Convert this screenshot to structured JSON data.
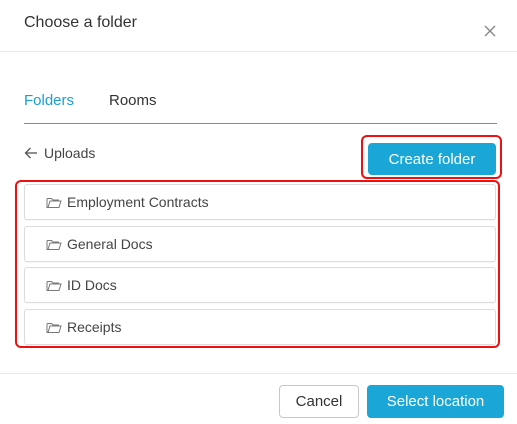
{
  "dialog": {
    "title": "Choose a folder",
    "close_icon": "close-icon"
  },
  "tabs": [
    {
      "label": "Folders",
      "active": true
    },
    {
      "label": "Rooms",
      "active": false
    }
  ],
  "navigation": {
    "back_icon": "arrow-left-icon",
    "back_label": "Uploads"
  },
  "actions": {
    "create_folder_label": "Create folder"
  },
  "folders": [
    {
      "label": "Employment Contracts",
      "icon": "folder-icon"
    },
    {
      "label": "General Docs",
      "icon": "folder-icon"
    },
    {
      "label": "ID Docs",
      "icon": "folder-icon"
    },
    {
      "label": "Receipts",
      "icon": "folder-icon"
    }
  ],
  "footer": {
    "cancel_label": "Cancel",
    "select_label": "Select location"
  },
  "colors": {
    "accent": "#1aa7d8",
    "active_tab": "#1aa0cf",
    "highlight": "#ee1111"
  }
}
